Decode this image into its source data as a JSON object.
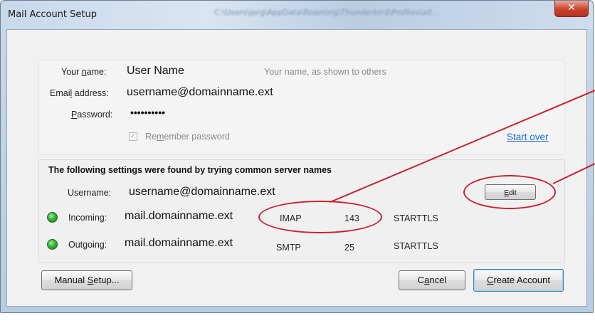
{
  "window": {
    "title": "Mail Account Setup",
    "path_text": "C:\\Users\\jorg\\AppData\\Roaming\\Thunderbird\\Profiles\\a0...",
    "close_glyph": "✕"
  },
  "form": {
    "name_label_pre": "Your ",
    "name_label_accel": "n",
    "name_label_post": "ame:",
    "name_value": "User Name",
    "name_hint": "Your name, as shown to others",
    "email_label_pre": "Emai",
    "email_label_accel": "l",
    "email_label_post": " address:",
    "email_value": "username@domainname.ext",
    "password_label_accel": "P",
    "password_label_post": "assword:",
    "password_value": "••••••••••",
    "remember_checked": true,
    "remember_check_glyph": "✓",
    "remember_label_pre": "Re",
    "remember_label_accel": "m",
    "remember_label_post": "ember password",
    "start_over": "Start over"
  },
  "settings": {
    "heading": "The following settings were found by trying common server names",
    "username_label": "Username:",
    "username_value": "username@domainname.ext",
    "edit_label_accel": "E",
    "edit_label_post": "dit",
    "incoming": {
      "label": "Incoming:",
      "server": "mail.domainname.ext",
      "protocol": "IMAP",
      "port": "143",
      "security": "STARTTLS",
      "status_color": "#35b13a"
    },
    "outgoing": {
      "label": "Outgoing:",
      "server": "mail.domainname.ext",
      "protocol": "SMTP",
      "port": "25",
      "security": "STARTTLS",
      "status_color": "#35b13a"
    }
  },
  "buttons": {
    "manual_setup_pre": "Manual ",
    "manual_setup_accel": "S",
    "manual_setup_post": "etup...",
    "cancel_pre": "C",
    "cancel_accel": "a",
    "cancel_post": "ncel",
    "create_accel": "C",
    "create_post": "reate Account"
  },
  "annotation": {
    "color": "#c8232b"
  }
}
